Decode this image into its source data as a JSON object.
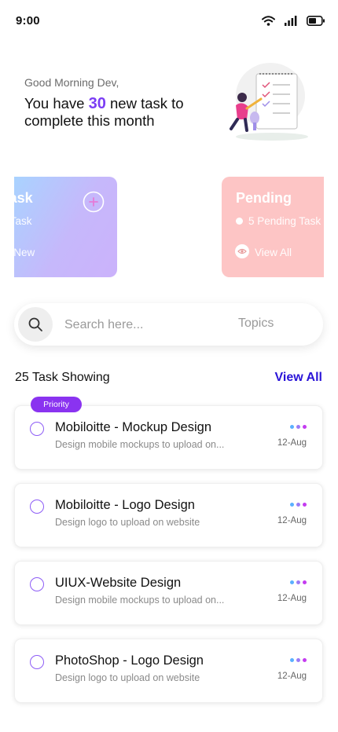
{
  "status": {
    "time": "9:00"
  },
  "greeting": {
    "subtitle": "Good Morning Dev,",
    "prefix": "You have ",
    "count": "30",
    "suffix": " new task to complete this month"
  },
  "cards": {
    "task": {
      "title": "Task",
      "line1": "ew Task",
      "line2": "d New"
    },
    "pending": {
      "title": "Pending",
      "line1": "5 Pending Task",
      "line2": "View All"
    }
  },
  "search": {
    "placeholder": "Search here...",
    "topics": "Topics"
  },
  "list": {
    "header": "25 Task Showing",
    "view_all": "View All",
    "priority_label": "Priority",
    "tasks": [
      {
        "title": "Mobiloitte - Mockup Design",
        "desc": "Design mobile mockups to upload on...",
        "date": "12-Aug"
      },
      {
        "title": "Mobiloitte - Logo Design",
        "desc": "Design logo to upload on website",
        "date": "12-Aug"
      },
      {
        "title": "UIUX-Website Design",
        "desc": "Design mobile mockups to upload on...",
        "date": "12-Aug"
      },
      {
        "title": "PhotoShop - Logo Design",
        "desc": "Design logo to upload on website",
        "date": "12-Aug"
      }
    ]
  },
  "colors": {
    "accent": "#7b3df4",
    "link": "#2a14d8",
    "priority": "#8a33f0",
    "pending_card": "#fdc5c5",
    "dots": [
      "#5ab0ff",
      "#9a7cf6",
      "#c43cf0"
    ]
  },
  "icons": [
    "wifi-icon",
    "signal-icon",
    "battery-icon",
    "plus-icon",
    "eye-icon",
    "search-icon",
    "more-dots-icon"
  ]
}
